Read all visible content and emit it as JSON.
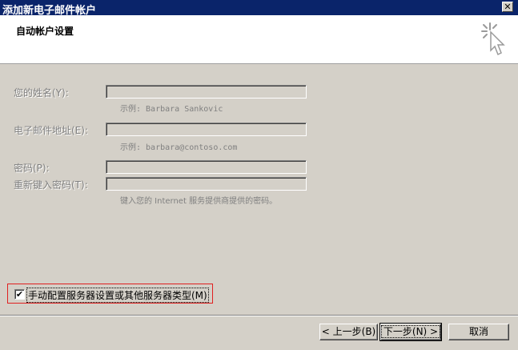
{
  "window": {
    "title": "添加新电子邮件帐户",
    "close_label": "✕"
  },
  "header": {
    "title": "自动帐户设置",
    "icon": "wizard-cursor-icon"
  },
  "form": {
    "name_label": "您的姓名(Y):",
    "name_value": "",
    "name_hint": "示例: Barbara Sankovic",
    "email_label": "电子邮件地址(E):",
    "email_value": "",
    "email_hint": "示例: barbara@contoso.com",
    "password_label": "密码(P):",
    "password_value": "",
    "retype_label": "重新键入密码(T):",
    "retype_value": "",
    "password_hint": "键入您的 Internet 服务提供商提供的密码。"
  },
  "manual": {
    "checked": true,
    "check_glyph": "✔",
    "label": "手动配置服务器设置或其他服务器类型(M)"
  },
  "buttons": {
    "back": "< 上一步(B)",
    "next": "下一步(N) >",
    "cancel": "取消"
  }
}
